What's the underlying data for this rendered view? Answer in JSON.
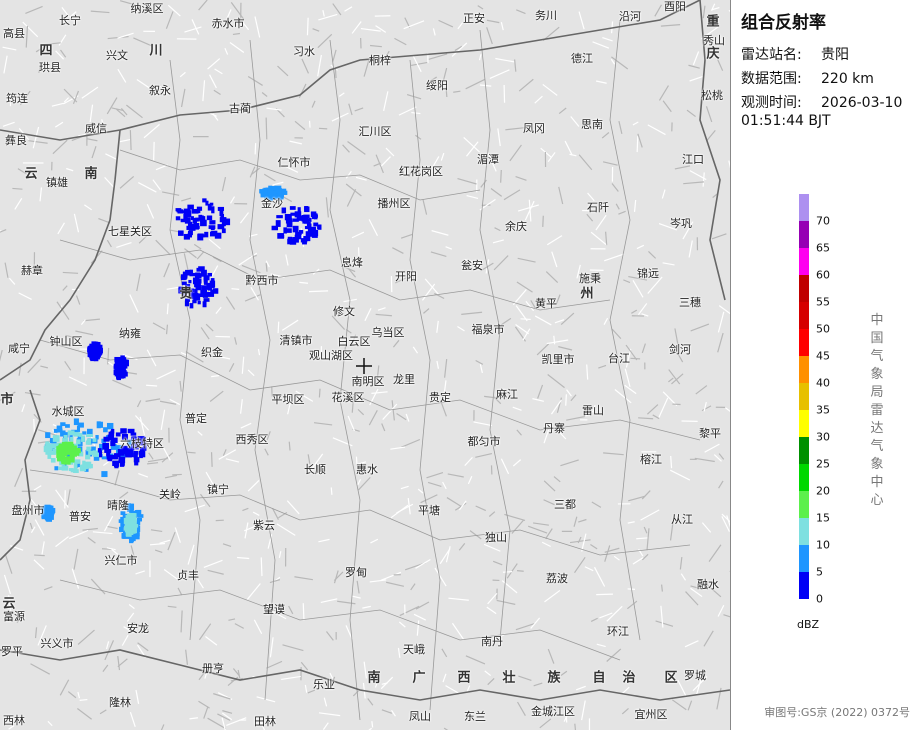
{
  "map": {
    "background_color": "#e4e4e4",
    "radar_center_marker": "crosshair-icon",
    "region_labels": [
      "四",
      "川",
      "云",
      "南",
      "贵",
      "州",
      "重",
      "庆",
      "市",
      "云",
      "南",
      "广",
      "西",
      "壮",
      "族",
      "自",
      "治",
      "区"
    ],
    "cities": [
      "高县",
      "长宁",
      "纳溪区",
      "赤水市",
      "正安",
      "务川",
      "沿河",
      "酉阳",
      "珙县",
      "兴文",
      "习水",
      "桐梓",
      "秀山",
      "筠连",
      "叙永",
      "古蔺",
      "绥阳",
      "德江",
      "松桃",
      "彝良",
      "威信",
      "汇川区",
      "凤冈",
      "思南",
      "仁怀市",
      "红花岗区",
      "湄潭",
      "江口",
      "镇雄",
      "金沙",
      "播州区",
      "石阡",
      "七星关区",
      "余庆",
      "岑巩",
      "赫章",
      "息烽",
      "开阳",
      "瓮安",
      "施秉",
      "锦远",
      "黔西市",
      "修文",
      "黄平",
      "三穗",
      "钟山区",
      "纳雍",
      "清镇市",
      "白云区",
      "乌当区",
      "福泉市",
      "剑河",
      "咸宁",
      "织金",
      "观山湖区",
      "南明区",
      "凯里市",
      "台江",
      "龙里",
      "水城区",
      "普定",
      "平坝区",
      "花溪区",
      "贵定",
      "麻江",
      "雷山",
      "黎平",
      "六枝特区",
      "西秀区",
      "都匀市",
      "丹寨",
      "榕江",
      "关岭",
      "镇宁",
      "长顺",
      "惠水",
      "盘州市",
      "晴隆",
      "普安",
      "三都",
      "平塘",
      "从江",
      "紫云",
      "兴仁市",
      "独山",
      "贞丰",
      "罗甸",
      "荔波",
      "融水",
      "富源",
      "安龙",
      "望谟",
      "环江",
      "兴义市",
      "天峨",
      "南丹",
      "罗平",
      "册亨",
      "乐业",
      "隆林",
      "田林",
      "凤山",
      "东兰",
      "金城江区",
      "宜州区",
      "西林",
      "罗城"
    ]
  },
  "panel": {
    "title": "组合反射率",
    "station_label": "雷达站名:",
    "station_value": "贵阳",
    "range_label": "数据范围:",
    "range_value": "220 km",
    "time_label": "观测时间:",
    "time_date": "2026-03-10",
    "time_clock": "01:51:44 BJT",
    "agency": "中国气象局雷达气象中心",
    "approval": "审图号:GS京 (2022) 0372号"
  },
  "legend": {
    "unit": "dBZ",
    "labels": [
      "70",
      "65",
      "60",
      "55",
      "50",
      "45",
      "40",
      "35",
      "30",
      "25",
      "20",
      "15",
      "10",
      "5",
      "0"
    ],
    "colors": [
      "#ad90f0",
      "#9600b4",
      "#ff00f0",
      "#c00000",
      "#d60000",
      "#ff0000",
      "#ff9000",
      "#e7c000",
      "#ffff00",
      "#009000",
      "#00d800",
      "#5cf04c",
      "#7ee0e0",
      "#1e96ff",
      "#0000f6"
    ]
  }
}
